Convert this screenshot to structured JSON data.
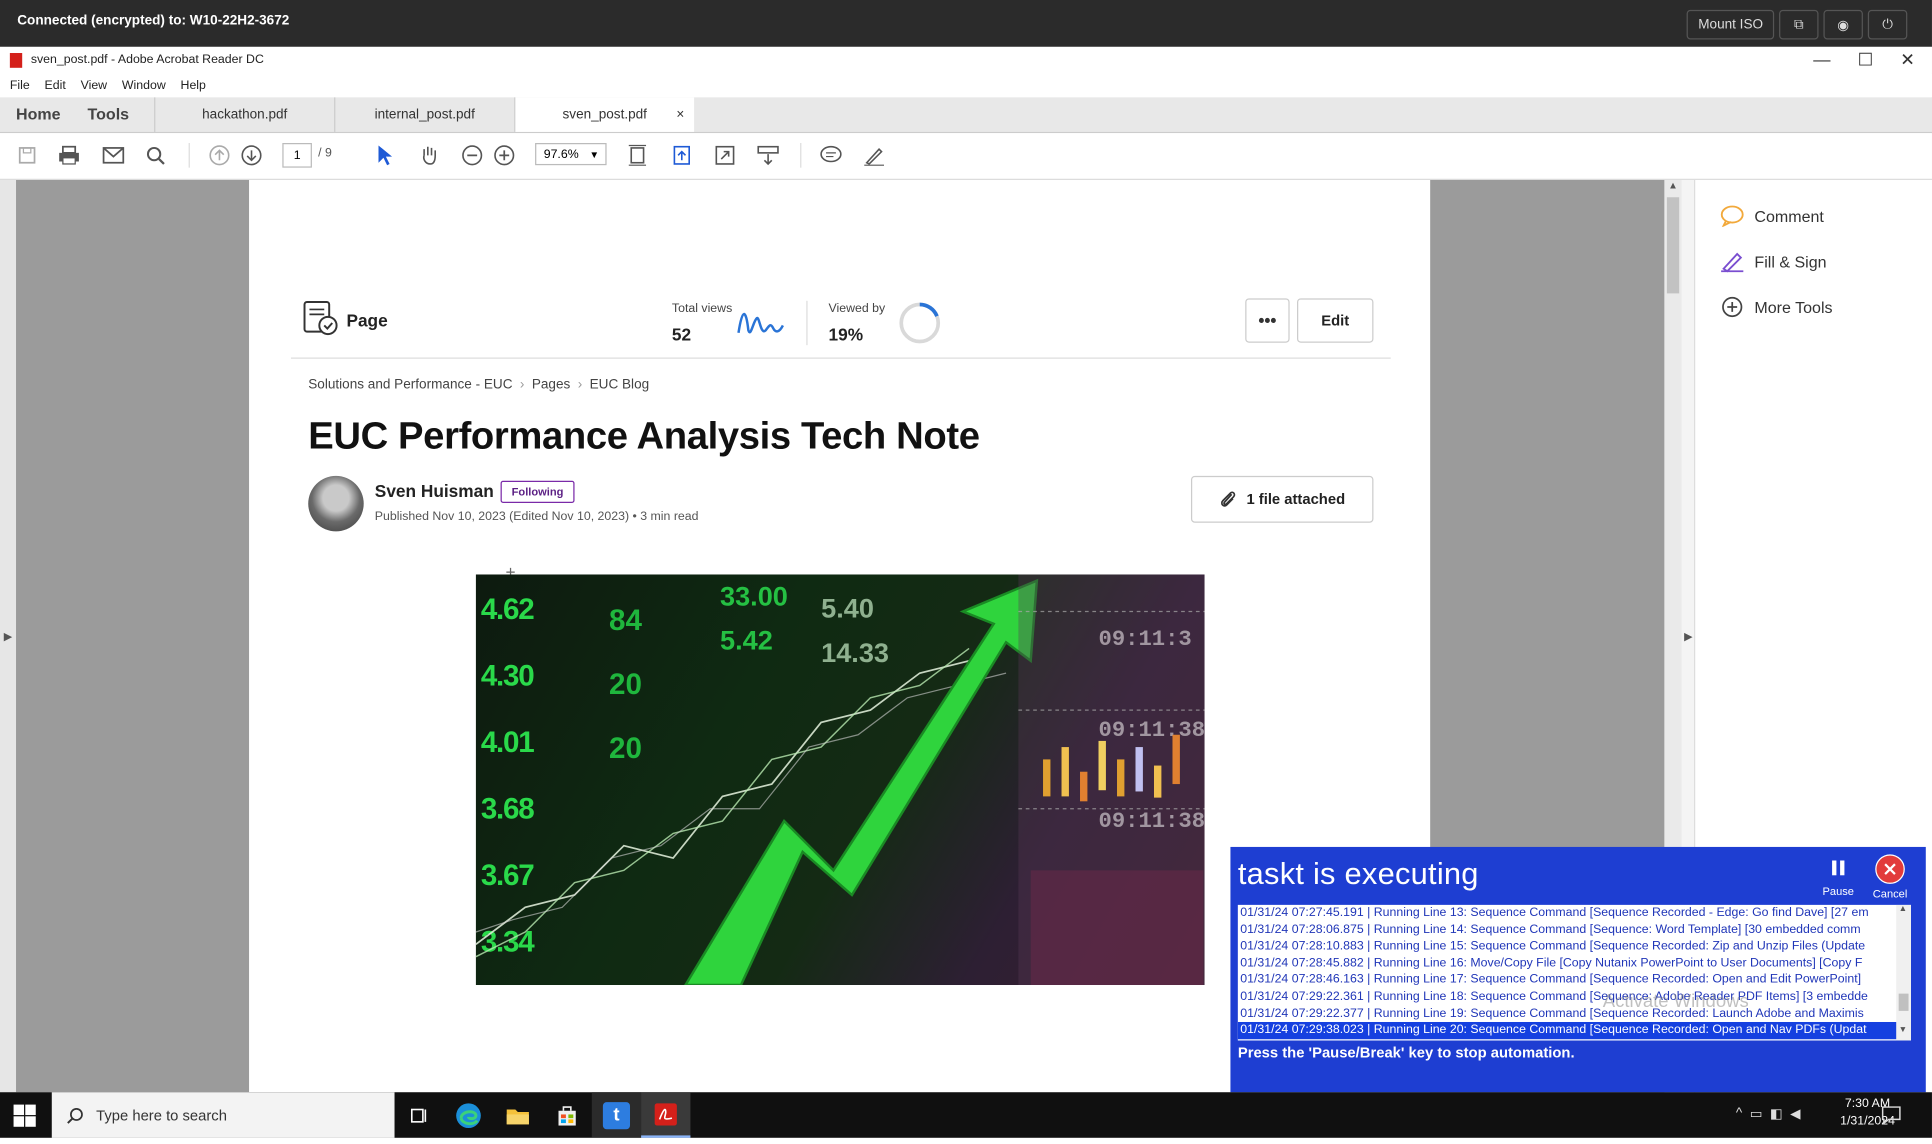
{
  "rdp": {
    "title": "Connected (encrypted) to: W10-22H2-3672",
    "mount_iso": "Mount ISO"
  },
  "window": {
    "title": "sven_post.pdf - Adobe Acrobat Reader DC"
  },
  "menu": [
    "File",
    "Edit",
    "View",
    "Window",
    "Help"
  ],
  "tabs": {
    "home": "Home",
    "tools": "Tools",
    "docs": [
      "hackathon.pdf",
      "internal_post.pdf",
      "sven_post.pdf"
    ],
    "close": "×"
  },
  "toolbar": {
    "page_current": "1",
    "page_total": "/ 9",
    "zoom": "97.6%"
  },
  "right_panel": {
    "comment": "Comment",
    "fill_sign": "Fill & Sign",
    "more_tools": "More Tools"
  },
  "page": {
    "page_label": "Page",
    "total_views_label": "Total views",
    "total_views": "52",
    "viewed_by_label": "Viewed by",
    "viewed_by": "19%",
    "more": "•••",
    "edit": "Edit",
    "breadcrumbs": [
      "Solutions and Performance - EUC",
      "Pages",
      "EUC Blog"
    ],
    "breadcrumb_sep": "›",
    "title": "EUC Performance Analysis Tech Note",
    "author": "Sven Huisman",
    "following": "Following",
    "published": "Published Nov 10, 2023 (Edited Nov 10, 2023) • 3 min read",
    "attachment": "1 file attached",
    "hero_numbers": [
      "4.62",
      "4.30",
      "4.01",
      "3.68",
      "3.67",
      "3.34"
    ],
    "hero_numbers_mid": [
      "84",
      "20",
      "20",
      "33.00",
      "5.42",
      "14.33",
      "5.40"
    ],
    "hero_times": [
      "09:11:3",
      "09:11:38",
      "09:11:38"
    ]
  },
  "taskt": {
    "title": "taskt is executing",
    "pause": "Pause",
    "cancel": "Cancel",
    "log": [
      "01/31/24 07:27:45.191 | Running Line 13: Sequence Command [Sequence Recorded - Edge: Go find Dave] [27 em",
      "01/31/24 07:28:06.875 | Running Line 14: Sequence Command [Sequence: Word Template] [30 embedded comm",
      "01/31/24 07:28:10.883 | Running Line 15: Sequence Command [Sequence Recorded: Zip and Unzip Files (Update",
      "01/31/24 07:28:45.882 | Running Line 16: Move/Copy File [Copy Nutanix PowerPoint to User Documents] [Copy F",
      "01/31/24 07:28:46.163 | Running Line 17: Sequence Command [Sequence Recorded: Open and Edit PowerPoint]",
      "01/31/24 07:29:22.361 | Running Line 18: Sequence Command [Sequence: Adobe Reader PDF Items] [3 embedde",
      "01/31/24 07:29:22.377 | Running Line 19: Sequence Command [Sequence Recorded: Launch Adobe and Maximis",
      "01/31/24 07:29:38.023 | Running Line 20: Sequence Command [Sequence Recorded: Open and Nav PDFs (Updat"
    ],
    "message": "Press the 'Pause/Break' key to stop automation.",
    "watermark": "Activate Windows"
  },
  "taskbar": {
    "search_placeholder": "Type here to search",
    "time": "7:30 AM",
    "date": "1/31/2024"
  }
}
